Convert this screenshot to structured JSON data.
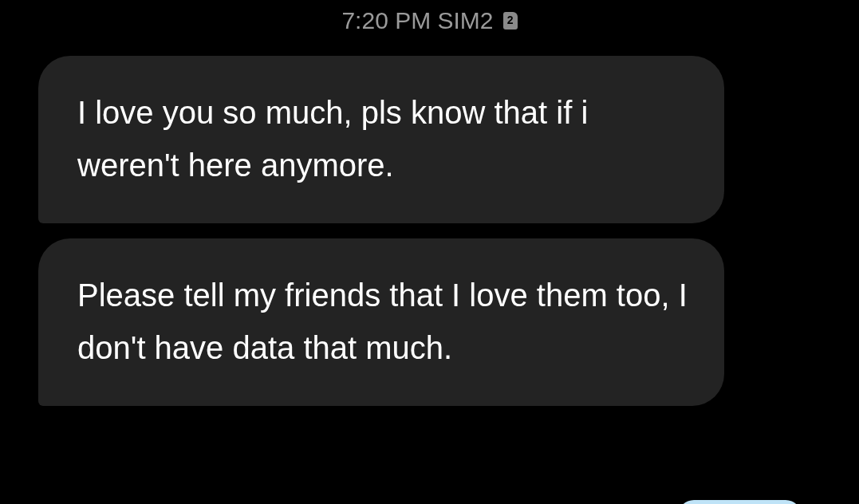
{
  "header": {
    "time": "7:20 PM",
    "sim": "SIM2",
    "sim_badge": "2"
  },
  "messages": [
    {
      "kind": "incoming",
      "text": "I love you so much, pls know that if i weren't here anymore."
    },
    {
      "kind": "incoming",
      "text": "Please tell my friends that I love them too, I don't have data that much."
    },
    {
      "kind": "outgoing"
    }
  ]
}
